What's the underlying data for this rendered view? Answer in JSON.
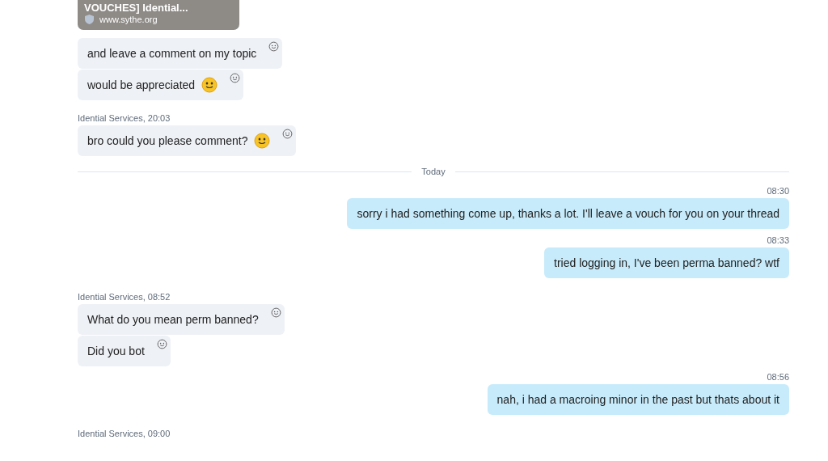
{
  "messages": [
    {
      "kind": "preview",
      "title": "VOUCHES] Idential...",
      "url": "www.sythe.org"
    },
    {
      "kind": "in",
      "text": "and leave a comment on my topic",
      "emoji": false
    },
    {
      "kind": "in",
      "text": "would be appreciated",
      "emoji": true
    },
    {
      "kind": "header",
      "text": "Idential Services, 20:03"
    },
    {
      "kind": "in",
      "text": "bro could you please comment?",
      "emoji": true
    },
    {
      "kind": "divider",
      "label": "Today"
    },
    {
      "kind": "out",
      "time": "08:30",
      "text": "sorry i had something come up, thanks a lot. I'll leave a vouch for you on your thread"
    },
    {
      "kind": "out",
      "time": "08:33",
      "text": "tried logging in, I've been perma banned? wtf"
    },
    {
      "kind": "header",
      "text": "Idential Services, 08:52"
    },
    {
      "kind": "in",
      "text": "What do you mean perm banned?",
      "emoji": false
    },
    {
      "kind": "in",
      "text": "Did you bot",
      "emoji": false
    },
    {
      "kind": "out",
      "time": "08:56",
      "text": "nah, i had a macroing minor in the past but thats about it"
    },
    {
      "kind": "header",
      "text": "Idential Services, 09:00"
    }
  ]
}
